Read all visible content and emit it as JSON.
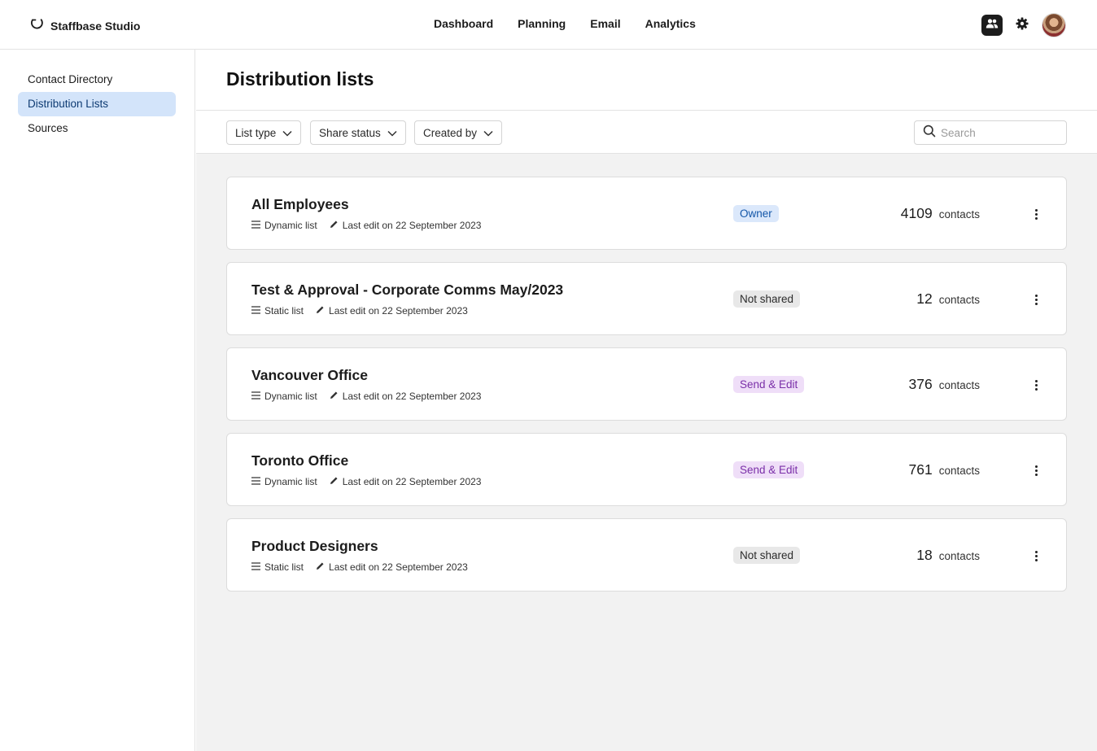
{
  "app": {
    "brand": "Staffbase Studio"
  },
  "nav": {
    "items": [
      "Dashboard",
      "Planning",
      "Email",
      "Analytics"
    ]
  },
  "top_actions": {
    "icons": [
      "people-icon",
      "gear-icon",
      "user-avatar"
    ]
  },
  "sidebar": {
    "items": [
      {
        "label": "Contact Directory",
        "active": false
      },
      {
        "label": "Distribution Lists",
        "active": true
      },
      {
        "label": "Sources",
        "active": false
      }
    ]
  },
  "page": {
    "title": "Distribution lists"
  },
  "filters": {
    "list_type": "List type",
    "share_status": "Share status",
    "created_by": "Created by",
    "search_placeholder": "Search"
  },
  "lists": [
    {
      "name": "All Employees",
      "type": "Dynamic list",
      "last_edit": "Last edit on 22 September 2023",
      "status": "Owner",
      "count": "4109",
      "count_label": "contacts"
    },
    {
      "name": "Test & Approval - Corporate Comms May/2023",
      "type": "Static list",
      "last_edit": "Last edit on 22 September 2023",
      "status": "Not shared",
      "count": "12",
      "count_label": "contacts"
    },
    {
      "name": "Vancouver Office",
      "type": "Dynamic list",
      "last_edit": "Last edit on 22 September 2023",
      "status": "Send & Edit",
      "count": "376",
      "count_label": "contacts"
    },
    {
      "name": "Toronto Office",
      "type": "Dynamic list",
      "last_edit": "Last edit on 22 September 2023",
      "status": "Send & Edit",
      "count": "761",
      "count_label": "contacts"
    },
    {
      "name": "Product Designers",
      "type": "Static list",
      "last_edit": "Last edit on 22 September 2023",
      "status": "Not shared",
      "count": "18",
      "count_label": "contacts"
    }
  ],
  "badge_colors": {
    "Owner": {
      "bg": "#dbe8fb",
      "fg": "#1356a8"
    },
    "Not shared": {
      "bg": "#e8e8e8",
      "fg": "#2b2b2b"
    },
    "Send & Edit": {
      "bg": "#efdef8",
      "fg": "#7a2fa8"
    }
  }
}
